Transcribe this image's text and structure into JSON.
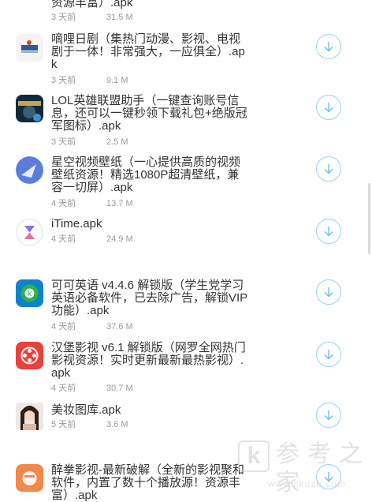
{
  "items": [
    {
      "title": "资源丰富）.apk",
      "date": "3 天前",
      "size": "31.5 M",
      "icon": "app-icon-partial",
      "download_icon": "download-arrow-icon"
    },
    {
      "title": "嘀哩日剧（集热门动漫、影视、电视剧于一体！非常强大，一应俱全）.apk",
      "date": "3 天前",
      "size": "9.1 M",
      "icon": "dilidrama-app-icon",
      "download_icon": "download-arrow-icon"
    },
    {
      "title": "LOL英雄联盟助手（一键查询账号信息，还可以一键秒领下载礼包+绝版冠军图标）.apk",
      "date": "3 天前",
      "size": "2.5 M",
      "icon": "lol-helper-app-icon",
      "download_icon": "download-arrow-icon"
    },
    {
      "title": "星空视频壁纸（一心提供高质的视频壁纸资源！精选1080P超清壁纸，兼容一切屏）.apk",
      "date": "4 天前",
      "size": "13.7 M",
      "icon": "starry-wallpaper-app-icon",
      "download_icon": "download-arrow-icon"
    },
    {
      "title": "iTime.apk",
      "date": "4 天前",
      "size": "24.9 M",
      "icon": "itime-app-icon",
      "download_icon": "download-arrow-icon"
    },
    {
      "title": "可可英语 v4.4.6 解锁版（学生党学习英语必备软件，已去除广告，解锁VIP功能）.apk",
      "date": "4 天前",
      "size": "37.6 M",
      "icon": "keke-english-app-icon",
      "download_icon": "download-arrow-icon"
    },
    {
      "title": "汉堡影视 v6.1 解锁版（网罗全网热门影视资源！实时更新最新最热影视）.apk",
      "date": "4 天前",
      "size": "30.7 M",
      "icon": "hamburger-video-app-icon",
      "download_icon": "download-arrow-icon"
    },
    {
      "title": "美妆图库.apk",
      "date": "5 天前",
      "size": "3.6 M",
      "icon": "beauty-gallery-app-icon",
      "download_icon": "download-arrow-icon"
    },
    {
      "title": "醉拳影视-最新破解（全新的影视聚和软件，内置了数十个播放源！资源丰富）.apk",
      "date": "",
      "size": "",
      "icon": "drunken-fist-app-icon",
      "download_icon": "download-arrow-icon"
    }
  ],
  "watermark": {
    "logo_char": "k",
    "text": "参考之家",
    "url": "www.ckdzb.com"
  },
  "colors": {
    "title": "#333333",
    "meta": "#999999",
    "download_ring": "#9bd3ee",
    "download_arrow": "#6cc0e8"
  }
}
